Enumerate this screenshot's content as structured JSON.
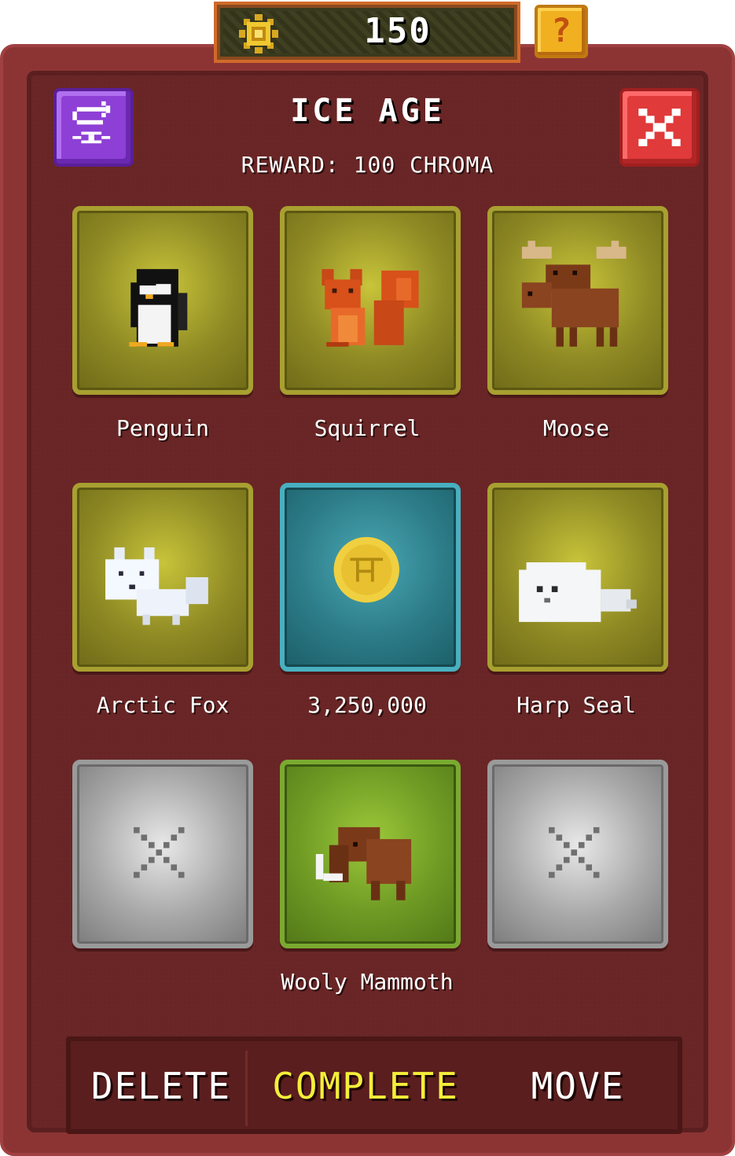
{
  "currency": {
    "amount": "150",
    "icon": "sun-gem-icon"
  },
  "help_button": {
    "label": "?"
  },
  "collection": {
    "title": "ICE AGE",
    "reward": "REWARD: 100 CHROMA"
  },
  "tiles": [
    {
      "label": "Penguin",
      "style": "gold",
      "icon": "penguin-icon"
    },
    {
      "label": "Squirrel",
      "style": "gold",
      "icon": "squirrel-icon"
    },
    {
      "label": "Moose",
      "style": "gold",
      "icon": "moose-icon"
    },
    {
      "label": "Arctic Fox",
      "style": "gold",
      "icon": "arctic-fox-icon"
    },
    {
      "label": "3,250,000",
      "style": "teal",
      "icon": "coin-icon"
    },
    {
      "label": "Harp Seal",
      "style": "gold",
      "icon": "harp-seal-icon"
    },
    {
      "label": "",
      "style": "empty",
      "icon": "empty-slot-icon"
    },
    {
      "label": "Wooly Mammoth",
      "style": "green",
      "icon": "mammoth-icon"
    },
    {
      "label": "",
      "style": "empty",
      "icon": "empty-slot-icon"
    }
  ],
  "actions": {
    "delete": "DELETE",
    "complete": "COMPLETE",
    "move": "MOVE"
  },
  "colors": {
    "panel": "#8c3434",
    "complete_accent": "#f4ee3a",
    "swap_button": "#8e3fd6",
    "close_button": "#e03a3a"
  }
}
